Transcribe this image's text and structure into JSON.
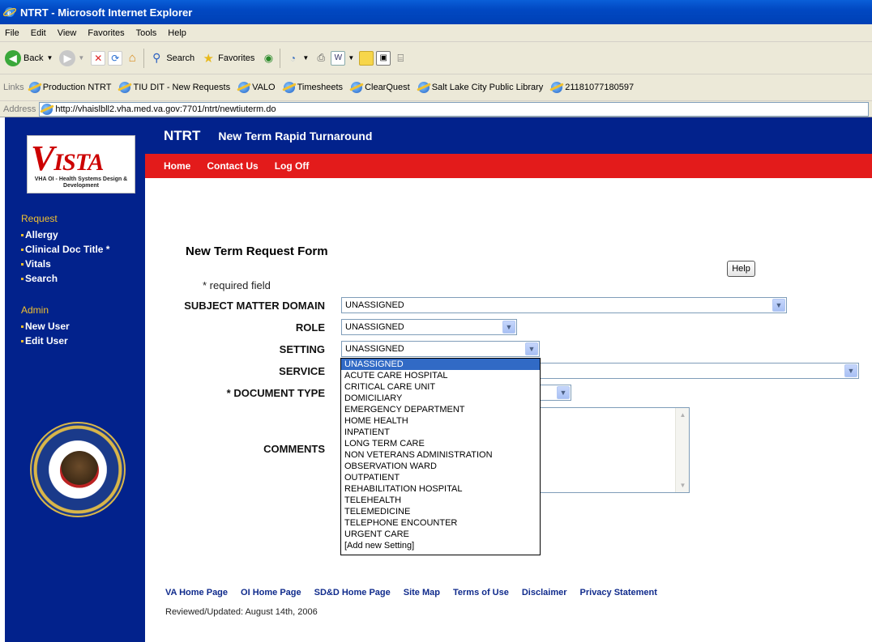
{
  "window": {
    "title": "NTRT - Microsoft Internet Explorer"
  },
  "menu": [
    "File",
    "Edit",
    "View",
    "Favorites",
    "Tools",
    "Help"
  ],
  "toolbar": {
    "back_label": "Back",
    "search_label": "Search",
    "favorites_label": "Favorites"
  },
  "links_bar": {
    "label": "Links",
    "items": [
      "Production NTRT",
      "TIU DIT - New Requests",
      "VALO",
      "Timesheets",
      "ClearQuest",
      "Salt Lake City Public Library",
      "21181077180597"
    ]
  },
  "address": {
    "label": "Address",
    "url": "http://vhaislbll2.vha.med.va.gov:7701/ntrt/newtiuterm.do"
  },
  "header": {
    "brand": "NTRT",
    "subtitle": "New Term Rapid Turnaround"
  },
  "topnav": [
    "Home",
    "Contact Us",
    "Log Off"
  ],
  "logo": {
    "text": "ISTA",
    "org": "VHA OI - Health Systems Design & Development"
  },
  "leftnav": {
    "request_heading": "Request",
    "request_items": [
      "Allergy",
      "Clinical Doc Title *",
      "Vitals",
      "Search"
    ],
    "admin_heading": "Admin",
    "admin_items": [
      "New User",
      "Edit User"
    ]
  },
  "form": {
    "title": "New Term Request Form",
    "help_label": "Help",
    "required_note": "* required field",
    "labels": {
      "subject": "SUBJECT MATTER DOMAIN",
      "role": "ROLE",
      "setting": "SETTING",
      "service": "SERVICE",
      "doctype": "* DOCUMENT TYPE",
      "comments": "COMMENTS"
    },
    "values": {
      "subject": "UNASSIGNED",
      "role": "UNASSIGNED",
      "setting": "UNASSIGNED"
    },
    "setting_options": [
      "UNASSIGNED",
      "ACUTE CARE HOSPITAL",
      "CRITICAL CARE UNIT",
      "DOMICILIARY",
      "EMERGENCY DEPARTMENT",
      "HOME HEALTH",
      "INPATIENT",
      "LONG TERM CARE",
      "NON VETERANS ADMINISTRATION",
      "OBSERVATION WARD",
      "OUTPATIENT",
      "REHABILITATION HOSPITAL",
      "TELEHEALTH",
      "TELEMEDICINE",
      "TELEPHONE ENCOUNTER",
      "URGENT CARE",
      "[Add new Setting]"
    ]
  },
  "footer": {
    "links": [
      "VA Home Page",
      "OI Home Page",
      "SD&D Home Page",
      "Site Map",
      "Terms of Use",
      "Disclaimer",
      "Privacy Statement"
    ],
    "reviewed": "Reviewed/Updated: August 14th, 2006"
  }
}
